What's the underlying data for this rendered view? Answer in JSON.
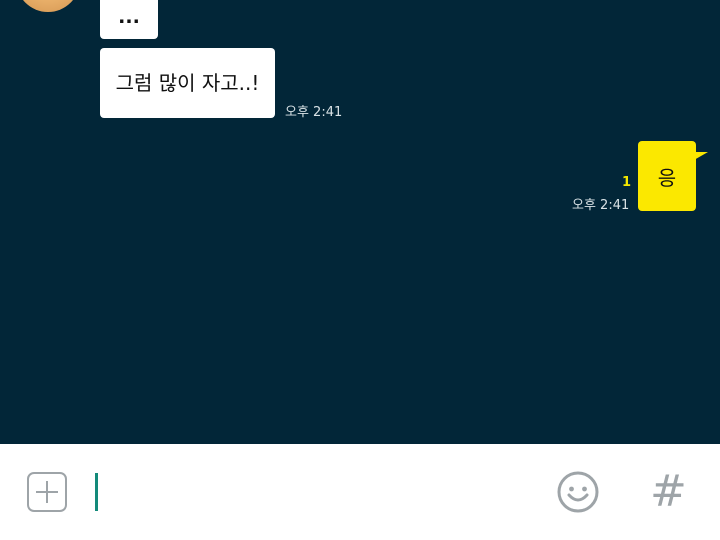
{
  "chat": {
    "messages": [
      {
        "sender": "other",
        "text": "..."
      },
      {
        "sender": "other",
        "text": "그럼 많이 자고..!",
        "time": "오후 2:41"
      },
      {
        "sender": "me",
        "text": "응",
        "unread_count": "1",
        "time": "오후 2:41"
      }
    ]
  },
  "composer": {
    "input_value": "",
    "icons": {
      "attach": "plus-icon",
      "emoji": "emoticon-icon",
      "hashtag": "hash-icon"
    },
    "hash_label": "#"
  },
  "colors": {
    "chat_background": "#022638",
    "my_bubble": "#fbe800",
    "unread": "#f4e800",
    "cursor": "#138a7a",
    "icon_gray": "#9ea4a8"
  }
}
